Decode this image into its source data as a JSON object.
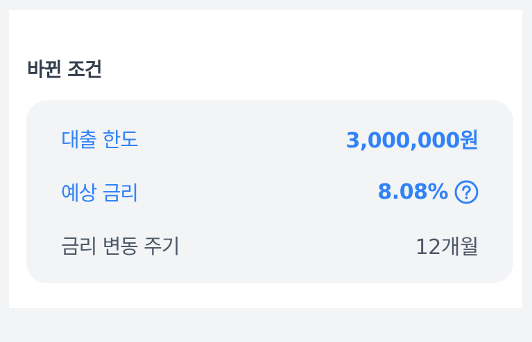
{
  "section": {
    "title": "바뀐 조건"
  },
  "conditions": [
    {
      "label": "대출 한도",
      "value": "3,000,000원"
    },
    {
      "label": "예상 금리",
      "value": "8.08%",
      "icon": "question-circle-icon"
    },
    {
      "label": "금리 변동 주기",
      "value": "12개월"
    }
  ],
  "colors": {
    "accent": "#3182f6",
    "text_dark": "#333d4b",
    "text_gray": "#4e5968",
    "box_bg": "#f2f4f6"
  }
}
